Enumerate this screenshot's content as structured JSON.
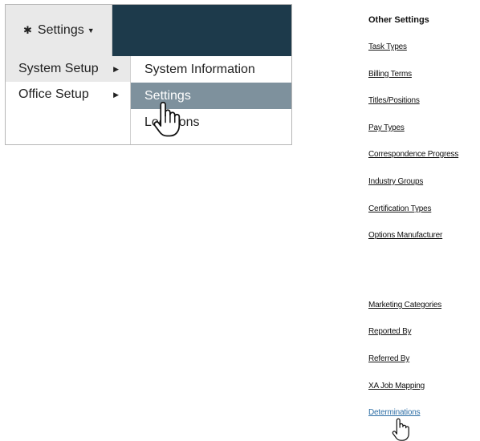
{
  "menu": {
    "settings_label": "Settings",
    "settings_icon": "gear-icon",
    "level1": [
      {
        "label": "System Setup",
        "active": true
      },
      {
        "label": "Office Setup",
        "active": false
      }
    ],
    "level2": [
      {
        "label": "System Information",
        "active": false
      },
      {
        "label": "Settings",
        "active": true
      },
      {
        "label": "Locations",
        "active": false
      }
    ],
    "colors": {
      "topbar": "#1d3a4b",
      "highlight": "#7e919d",
      "hover_bg": "#e9e9e9"
    }
  },
  "other_settings": {
    "title": "Other Settings",
    "group1": [
      "Task Types",
      "Billing Terms",
      "Titles/Positions",
      "Pay Types",
      "Correspondence Progress",
      "Industry Groups",
      "Certification Types",
      "Options Manufacturer"
    ],
    "group2": [
      "Marketing Categories",
      "Reported By",
      "Referred By",
      "XA Job Mapping",
      "Determinations"
    ],
    "link_color_active": "#2f6fa6"
  }
}
